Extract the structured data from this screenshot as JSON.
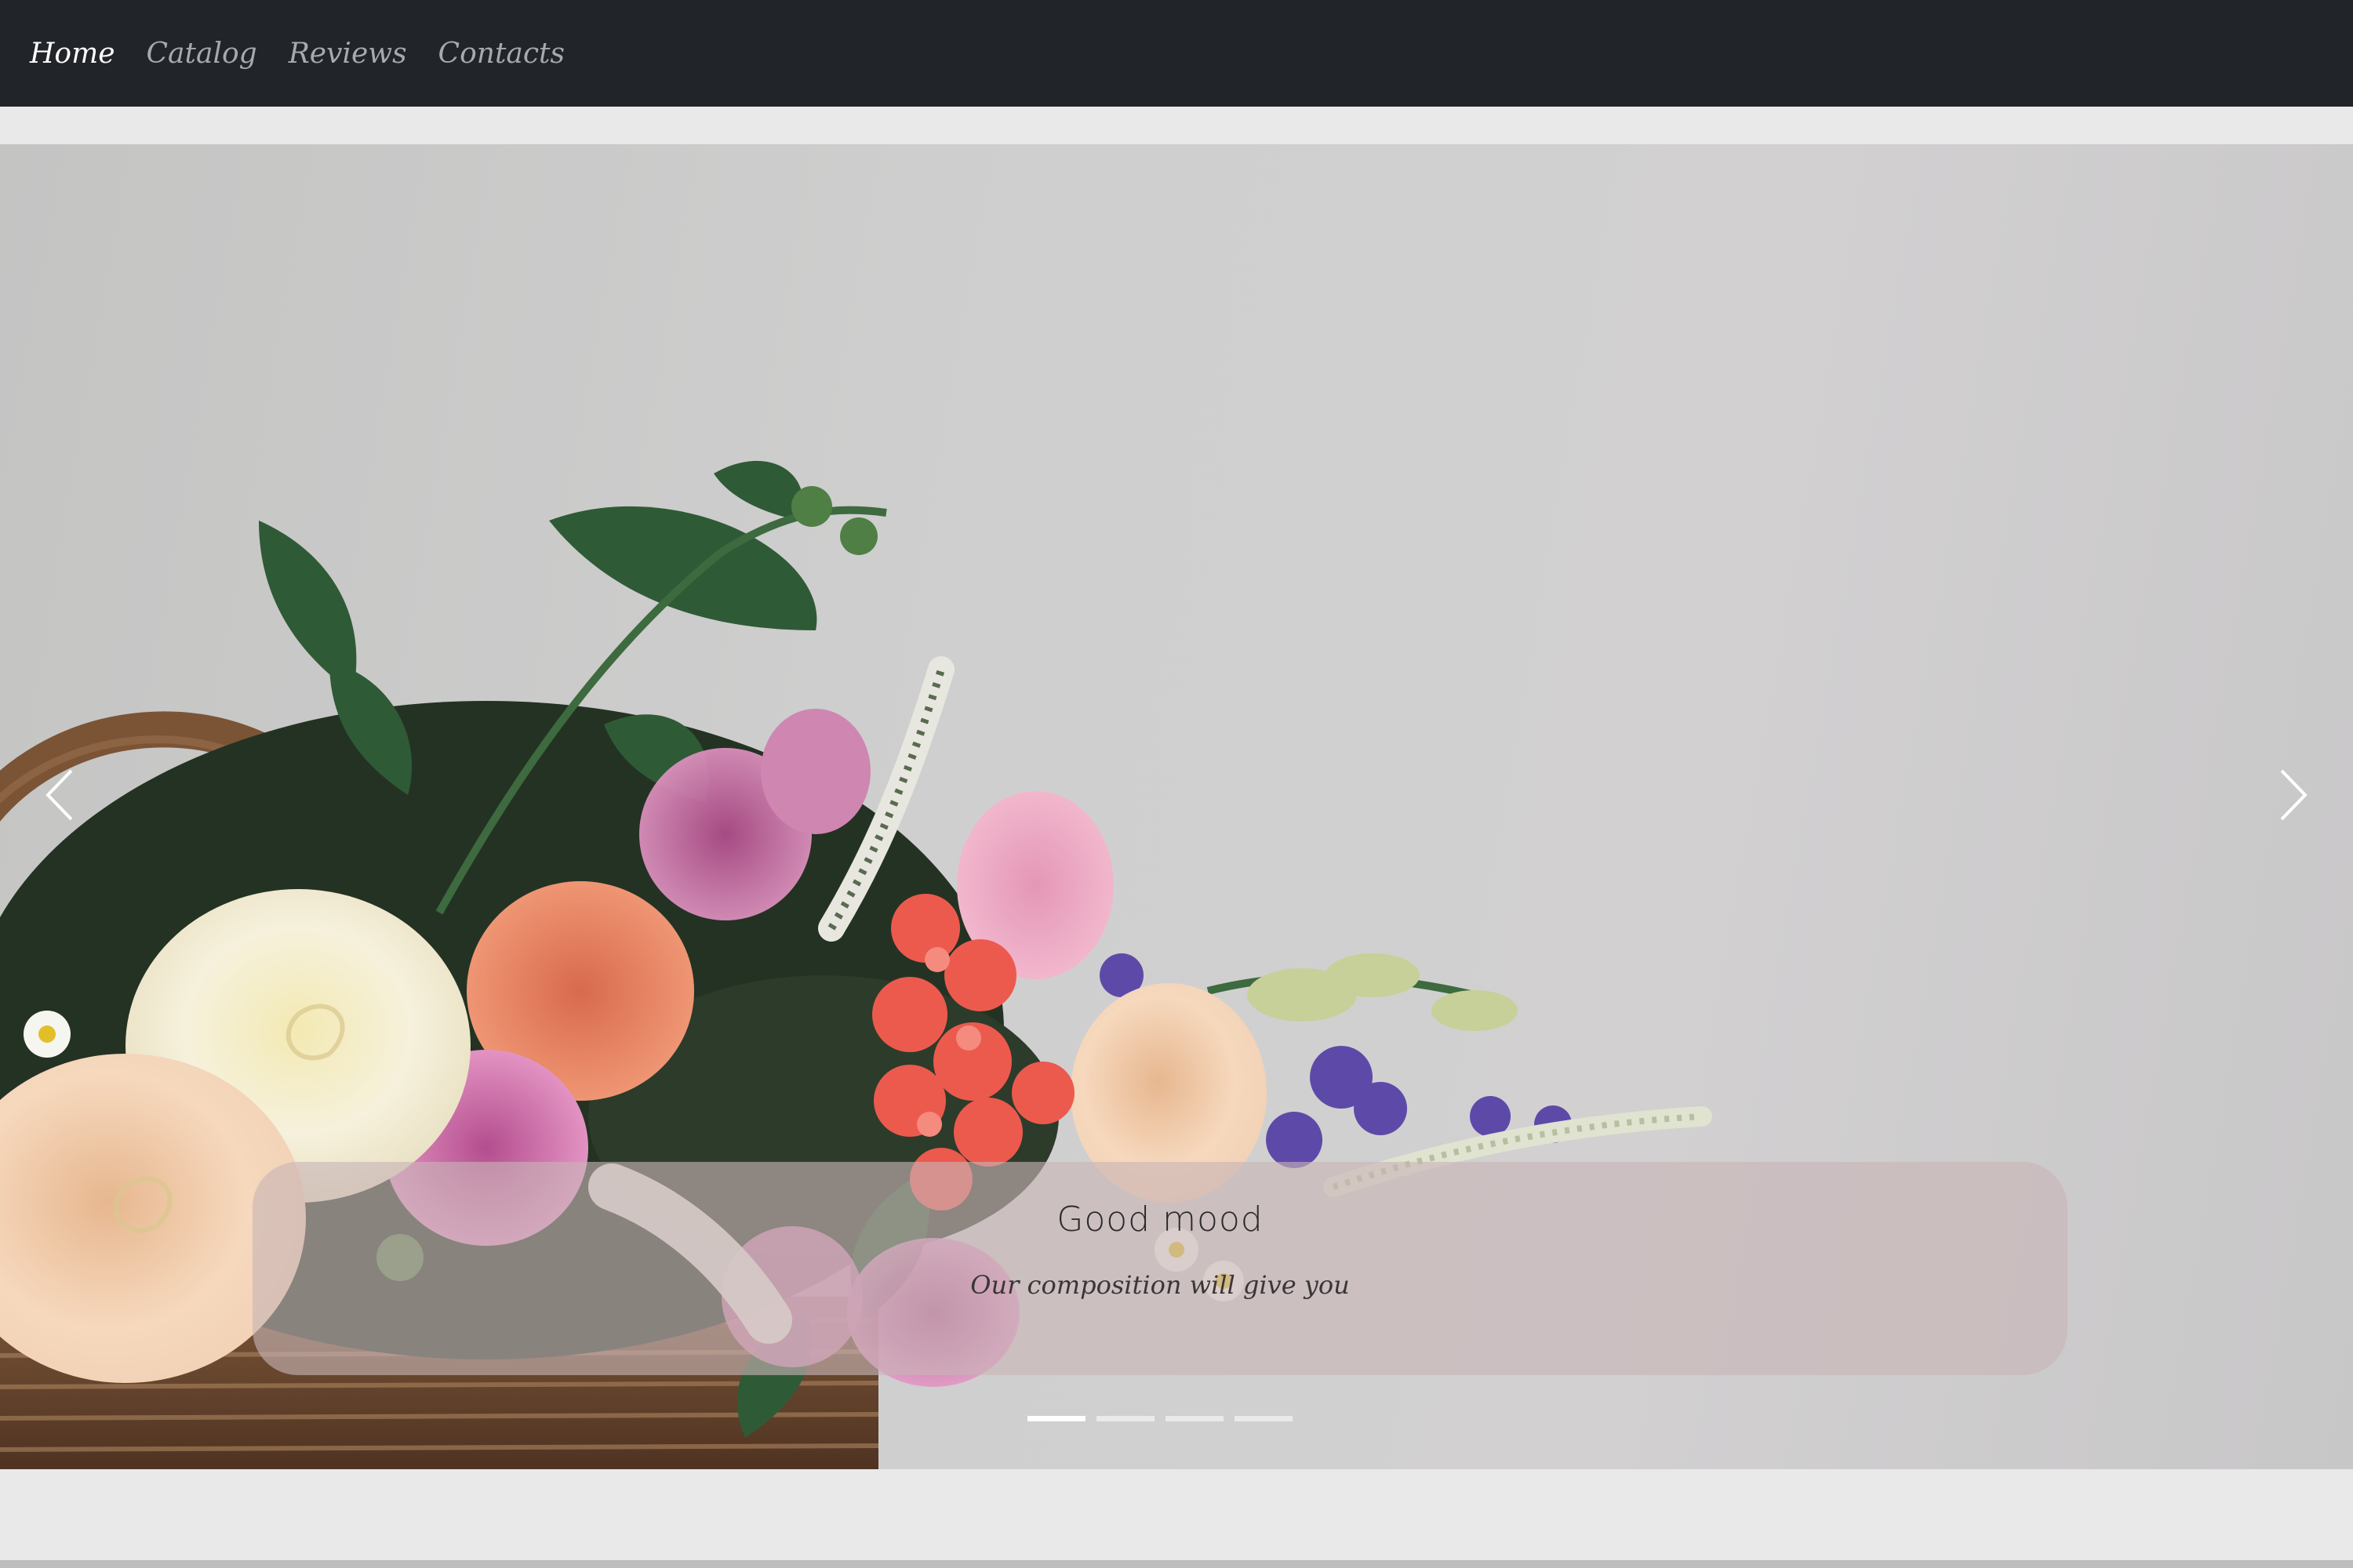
{
  "nav": {
    "links": [
      {
        "label": "Home",
        "active": true
      },
      {
        "label": "Catalog",
        "active": false
      },
      {
        "label": "Reviews",
        "active": false
      },
      {
        "label": "Contacts",
        "active": false
      }
    ]
  },
  "carousel": {
    "prev_icon": "chevron-left-icon",
    "next_icon": "chevron-right-icon",
    "caption": {
      "title": "Good mood",
      "text": "Our composition will give you"
    },
    "slide_count": 4,
    "active_slide": 1
  },
  "colors": {
    "navbar_bg": "#212429",
    "nav_active": "#ffffff",
    "nav_inactive": "#a7a9ac",
    "page_bg": "#e9e9e9",
    "caption_bg": "#c8b4b6"
  }
}
